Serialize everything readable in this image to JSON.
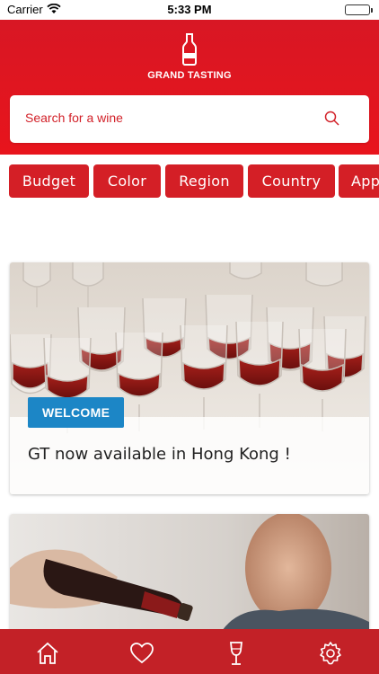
{
  "status_bar": {
    "carrier": "Carrier",
    "time": "5:33 PM"
  },
  "header": {
    "logo_title": "GRAND TASTING",
    "logo_icon": "wine-bottle-icon"
  },
  "search": {
    "placeholder": "Search for a wine",
    "icon": "search-icon"
  },
  "filters": [
    {
      "label": "Budget"
    },
    {
      "label": "Color"
    },
    {
      "label": "Region"
    },
    {
      "label": "Country"
    },
    {
      "label": "App"
    }
  ],
  "cards": [
    {
      "badge": "WELCOME",
      "title": "GT now available in Hong Kong !"
    }
  ],
  "tab_bar": [
    {
      "name": "home",
      "icon": "home-icon"
    },
    {
      "name": "favorites",
      "icon": "heart-icon"
    },
    {
      "name": "tasting",
      "icon": "wine-glass-icon"
    },
    {
      "name": "settings",
      "icon": "gear-icon"
    }
  ],
  "colors": {
    "brand_red": "#e8141c",
    "badge_blue": "#1c86c6",
    "tab_red": "#c32127"
  }
}
